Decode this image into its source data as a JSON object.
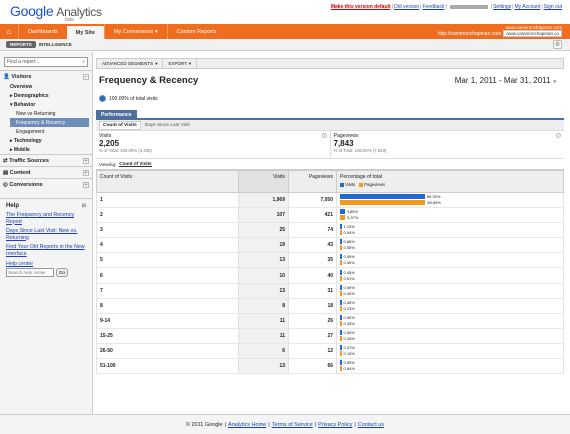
{
  "brand": {
    "google": "Google",
    "analytics": "Analytics",
    "beta": "beta"
  },
  "toplinks": {
    "make_default": "Make this version default",
    "old_version": "Old version",
    "feedback": "Feedback",
    "settings": "Settings",
    "my_account": "My Account",
    "sign_out": "Sign out"
  },
  "nav": {
    "home_icon": "home-icon",
    "items": [
      "Dashboards",
      "My Site",
      "My Conversions",
      "Custom Reports"
    ]
  },
  "account": {
    "line1": "www.cameronchapman.com",
    "url": "http://cameronchapman.com",
    "property": "www.cameronchapman.co"
  },
  "subbar": {
    "reports": "REPORTS",
    "intelligence": "INTELLIGENCE"
  },
  "sidebar": {
    "search_placeholder": "Find a report...",
    "visitors": "Visitors",
    "items": [
      "Overview",
      "Demographics",
      "Behavior",
      "New vs Returning",
      "Frequency & Recency",
      "Engagement",
      "Technology",
      "Mobile"
    ],
    "sections": [
      "Traffic Sources",
      "Content",
      "Conversions"
    ],
    "help": {
      "title": "Help",
      "links": [
        "The Frequency and Recency Report",
        "Days Since Last Visit: New vs. Returning",
        "Find Your Old Reports in the New Interface"
      ],
      "center": "Help center",
      "input_placeholder": "Search help center",
      "go": "Go"
    }
  },
  "toolbar": {
    "segments": "ADVANCED SEGMENTS",
    "export": "EXPORT"
  },
  "report": {
    "title": "Frequency & Recency",
    "date_range": "Mar 1, 2011 - Mar 31, 2011",
    "pct_visits": "100.00% of total visits",
    "tab": "Performance",
    "subtabs": [
      "Count of Visits",
      "Days Since Last Visit"
    ]
  },
  "summary": [
    {
      "label": "Visits",
      "value": "2,205",
      "sub": "% of Total: 100.00% (2,205)"
    },
    {
      "label": "Pageviews",
      "value": "7,843",
      "sub": "% of Total: 100.00% (7,843)"
    }
  ],
  "viewing": {
    "label": "Viewing:",
    "option": "Count of Visits"
  },
  "table": {
    "headers": [
      "Count of Visits",
      "Visits",
      "Pageviews",
      "Percentage of total"
    ],
    "legend": [
      "Visits",
      "Pageviews"
    ],
    "colors": {
      "visits": "#1f6ad6",
      "pageviews": "#f39a1d"
    },
    "rows": [
      {
        "count": "1",
        "visits": "1,969",
        "pageviews": "7,050",
        "pv": 89.3,
        "pp": 89.89,
        "pv_label": "89.30%",
        "pp_label": "89.89%"
      },
      {
        "count": "2",
        "visits": "107",
        "pageviews": "421",
        "pv": 4.85,
        "pp": 5.37,
        "pv_label": "4.85%",
        "pp_label": "5.37%"
      },
      {
        "count": "3",
        "visits": "25",
        "pageviews": "74",
        "pv": 1.13,
        "pp": 0.94,
        "pv_label": "1.13%",
        "pp_label": "0.94%"
      },
      {
        "count": "4",
        "visits": "19",
        "pageviews": "43",
        "pv": 0.86,
        "pp": 0.55,
        "pv_label": "0.86%",
        "pp_label": "0.55%"
      },
      {
        "count": "5",
        "visits": "13",
        "pageviews": "35",
        "pv": 0.59,
        "pp": 0.45,
        "pv_label": "0.59%",
        "pp_label": "0.45%"
      },
      {
        "count": "6",
        "visits": "10",
        "pageviews": "40",
        "pv": 0.45,
        "pp": 0.51,
        "pv_label": "0.45%",
        "pp_label": "0.51%"
      },
      {
        "count": "7",
        "visits": "13",
        "pageviews": "31",
        "pv": 0.59,
        "pp": 0.4,
        "pv_label": "0.59%",
        "pp_label": "0.40%"
      },
      {
        "count": "8",
        "visits": "8",
        "pageviews": "18",
        "pv": 0.36,
        "pp": 0.23,
        "pv_label": "0.36%",
        "pp_label": "0.23%"
      },
      {
        "count": "9-14",
        "visits": "11",
        "pageviews": "26",
        "pv": 0.5,
        "pp": 0.33,
        "pv_label": "0.50%",
        "pp_label": "0.33%"
      },
      {
        "count": "15-25",
        "visits": "11",
        "pageviews": "27",
        "pv": 0.5,
        "pp": 0.34,
        "pv_label": "0.50%",
        "pp_label": "0.34%"
      },
      {
        "count": "26-50",
        "visits": "6",
        "pageviews": "12",
        "pv": 0.27,
        "pp": 0.15,
        "pv_label": "0.27%",
        "pp_label": "0.15%"
      },
      {
        "count": "51-100",
        "visits": "13",
        "pageviews": "66",
        "pv": 0.59,
        "pp": 0.84,
        "pv_label": "0.59%",
        "pp_label": "0.84%"
      }
    ]
  },
  "footer": {
    "copyright": "© 2011 Google",
    "links": [
      "Analytics Home",
      "Terms of Service",
      "Privacy Policy",
      "Contact us"
    ]
  }
}
